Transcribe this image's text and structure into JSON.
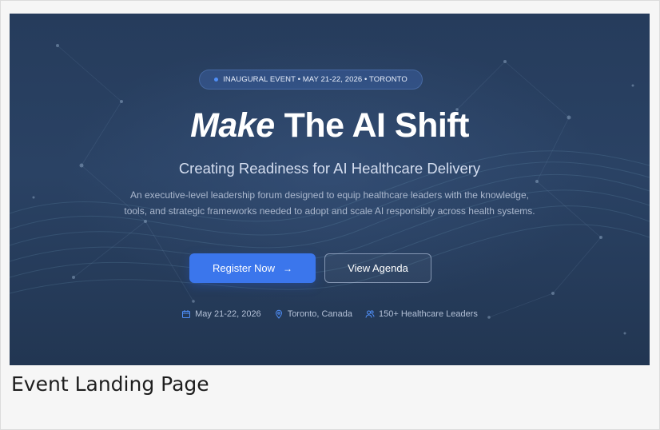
{
  "hero": {
    "badge_text": "INAUGURAL EVENT • MAY 21-22, 2026 • TORONTO",
    "headline_emphasis": "Make",
    "headline_rest": "The AI Shift",
    "subtitle": "Creating Readiness for AI Healthcare Delivery",
    "description": "An executive-level leadership forum designed to equip healthcare leaders with the knowledge, tools, and strategic frameworks needed to adopt and scale AI responsibly across health systems.",
    "primary_button": {
      "label": "Register Now",
      "icon": "arrow-right-icon"
    },
    "secondary_button": {
      "label": "View Agenda"
    },
    "meta": [
      {
        "icon": "calendar-icon",
        "text": "May 21-22, 2026"
      },
      {
        "icon": "location-pin-icon",
        "text": "Toronto, Canada"
      },
      {
        "icon": "users-icon",
        "text": "150+ Healthcare Leaders"
      }
    ]
  },
  "caption": "Event Landing Page",
  "colors": {
    "hero_background": "#263c5c",
    "accent": "#3b76ec",
    "badge_dot": "#4f8ef7",
    "page_background": "#f6f6f6"
  }
}
